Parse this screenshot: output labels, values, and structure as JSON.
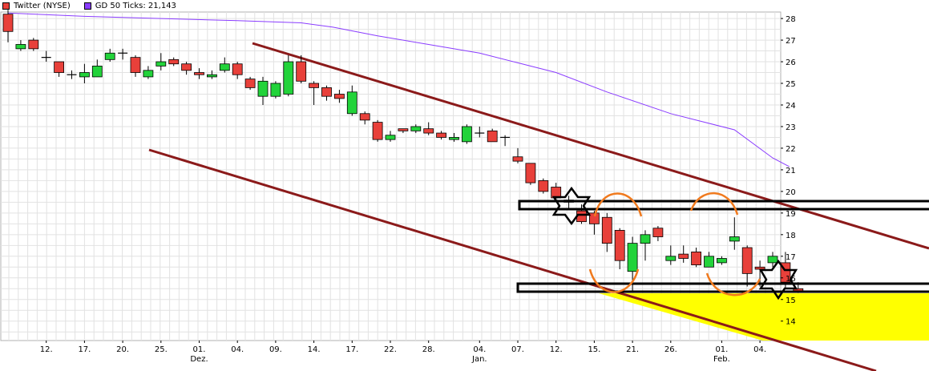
{
  "legend": [
    {
      "label": "Twitter (NYSE)",
      "color": "#e8403a"
    },
    {
      "label": "GD 50 Ticks: 21,143",
      "color": "#8a3cff"
    }
  ],
  "chart_data": {
    "type": "candlestick",
    "y_ticks": [
      14,
      15,
      16,
      17,
      18,
      19,
      20,
      21,
      22,
      23,
      24,
      25,
      26,
      27,
      28
    ],
    "ylim": [
      13.1,
      28.3
    ],
    "x_ticks": [
      {
        "i": 3,
        "label": "12."
      },
      {
        "i": 6,
        "label": "17."
      },
      {
        "i": 9,
        "label": "20."
      },
      {
        "i": 12,
        "label": "25."
      },
      {
        "i": 15,
        "label": "01.",
        "sub": "Dez."
      },
      {
        "i": 18,
        "label": "04."
      },
      {
        "i": 21,
        "label": "09."
      },
      {
        "i": 24,
        "label": "14."
      },
      {
        "i": 27,
        "label": "17."
      },
      {
        "i": 30,
        "label": "22."
      },
      {
        "i": 33,
        "label": "28."
      },
      {
        "i": 37,
        "label": "04.",
        "sub": "Jan."
      },
      {
        "i": 40,
        "label": "07."
      },
      {
        "i": 43,
        "label": "12."
      },
      {
        "i": 46,
        "label": "15."
      },
      {
        "i": 49,
        "label": "21."
      },
      {
        "i": 52,
        "label": "26."
      },
      {
        "i": 56,
        "label": "01.",
        "sub": "Feb."
      },
      {
        "i": 59,
        "label": "04."
      }
    ],
    "candles": [
      [
        28.2,
        27.4,
        28.4,
        26.9
      ],
      [
        26.6,
        26.8,
        27.0,
        26.5
      ],
      [
        27.0,
        26.6,
        27.1,
        26.5
      ],
      [
        26.2,
        26.2,
        26.5,
        26.0
      ],
      [
        26.0,
        25.5,
        26.0,
        25.3
      ],
      [
        25.4,
        25.4,
        25.6,
        25.2
      ],
      [
        25.3,
        25.5,
        25.9,
        25.0
      ],
      [
        25.3,
        25.8,
        26.1,
        25.3
      ],
      [
        26.1,
        26.4,
        26.6,
        26.0
      ],
      [
        26.4,
        26.4,
        26.6,
        26.1
      ],
      [
        26.2,
        25.5,
        26.3,
        25.3
      ],
      [
        25.3,
        25.6,
        25.8,
        25.2
      ],
      [
        25.8,
        26.0,
        26.4,
        25.6
      ],
      [
        26.1,
        25.9,
        26.2,
        25.8
      ],
      [
        25.9,
        25.6,
        26.0,
        25.4
      ],
      [
        25.5,
        25.4,
        25.7,
        25.2
      ],
      [
        25.3,
        25.4,
        25.6,
        25.2
      ],
      [
        25.6,
        25.9,
        26.2,
        25.5
      ],
      [
        25.9,
        25.4,
        26.0,
        25.2
      ],
      [
        25.2,
        24.8,
        25.3,
        24.7
      ],
      [
        24.4,
        25.1,
        25.3,
        24.0
      ],
      [
        24.4,
        25.0,
        25.1,
        24.3
      ],
      [
        24.5,
        26.0,
        26.3,
        24.4
      ],
      [
        26.0,
        25.1,
        26.3,
        25.0
      ],
      [
        25.0,
        24.8,
        25.1,
        24.0
      ],
      [
        24.8,
        24.4,
        24.9,
        24.2
      ],
      [
        24.5,
        24.3,
        24.7,
        24.1
      ],
      [
        23.6,
        24.6,
        24.9,
        23.5
      ],
      [
        23.6,
        23.3,
        23.7,
        23.1
      ],
      [
        23.2,
        22.4,
        23.3,
        22.3
      ],
      [
        22.4,
        22.6,
        22.8,
        22.3
      ],
      [
        22.9,
        22.8,
        22.9,
        22.7
      ],
      [
        22.8,
        23.0,
        23.1,
        22.7
      ],
      [
        22.9,
        22.7,
        23.2,
        22.6
      ],
      [
        22.7,
        22.5,
        22.8,
        22.4
      ],
      [
        22.4,
        22.5,
        22.7,
        22.3
      ],
      [
        22.3,
        23.0,
        23.1,
        22.2
      ],
      [
        22.7,
        22.7,
        23.0,
        22.5
      ],
      [
        22.8,
        22.3,
        22.9,
        22.3
      ],
      [
        22.5,
        22.5,
        22.6,
        22.1
      ],
      [
        21.6,
        21.4,
        22.0,
        21.3
      ],
      [
        21.3,
        20.4,
        21.3,
        20.3
      ],
      [
        20.5,
        20.0,
        20.6,
        19.9
      ],
      [
        20.2,
        19.7,
        20.4,
        19.5
      ],
      [
        19.6,
        19.5,
        19.8,
        19.2
      ],
      [
        19.1,
        18.6,
        19.4,
        18.5
      ],
      [
        19.0,
        18.5,
        19.1,
        18.0
      ],
      [
        18.8,
        17.6,
        19.0,
        17.2
      ],
      [
        18.2,
        16.8,
        18.3,
        16.4
      ],
      [
        16.3,
        17.6,
        17.9,
        15.4
      ],
      [
        17.6,
        18.0,
        18.2,
        16.8
      ],
      [
        18.3,
        17.9,
        18.4,
        17.7
      ],
      [
        16.8,
        17.0,
        17.5,
        16.6
      ],
      [
        17.1,
        16.9,
        17.5,
        16.7
      ],
      [
        17.2,
        16.6,
        17.4,
        16.5
      ],
      [
        16.5,
        17.0,
        17.2,
        16.5
      ],
      [
        16.7,
        16.9,
        17.0,
        16.6
      ],
      [
        17.7,
        17.9,
        18.8,
        17.3
      ],
      [
        17.4,
        16.2,
        17.5,
        15.6
      ],
      [
        16.5,
        16.4,
        16.8,
        15.6
      ],
      [
        16.7,
        17.0,
        17.2,
        16.5
      ],
      [
        16.7,
        15.8,
        17.2,
        15.5
      ],
      [
        15.5,
        15.4,
        15.8,
        15.3
      ]
    ],
    "moving_average": [
      [
        0,
        28.25
      ],
      [
        6,
        28.1
      ],
      [
        12,
        28.0
      ],
      [
        18,
        27.9
      ],
      [
        23,
        27.8
      ],
      [
        25.5,
        27.6
      ],
      [
        29,
        27.2
      ],
      [
        33,
        26.8
      ],
      [
        37,
        26.4
      ],
      [
        40,
        25.95
      ],
      [
        43,
        25.5
      ],
      [
        47,
        24.6
      ],
      [
        52,
        23.6
      ],
      [
        57,
        22.85
      ],
      [
        60,
        21.55
      ],
      [
        61.3,
        21.15
      ]
    ]
  }
}
